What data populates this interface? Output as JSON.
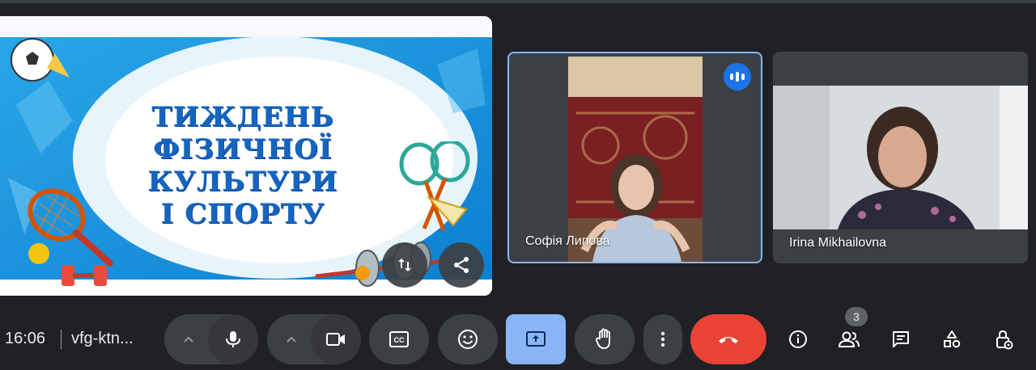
{
  "slide": {
    "title_lines": [
      "ТИЖДЕНЬ",
      "ФІЗИЧНОЇ",
      "КУЛЬТУРИ",
      "І СПОРТУ"
    ]
  },
  "participants": [
    {
      "name": "Софія Липова",
      "speaking": true
    },
    {
      "name": "Irina Mikhailovna",
      "speaking": false
    }
  ],
  "bottom_bar": {
    "time": "16:06",
    "meeting_code": "vfg-ktn...",
    "people_count": "3"
  },
  "colors": {
    "background": "#202124",
    "button": "#3c4043",
    "present_active": "#8ab4f8",
    "end_call": "#ea4335",
    "speaking_badge": "#1a73e8",
    "slide_title": "#1565c0"
  }
}
